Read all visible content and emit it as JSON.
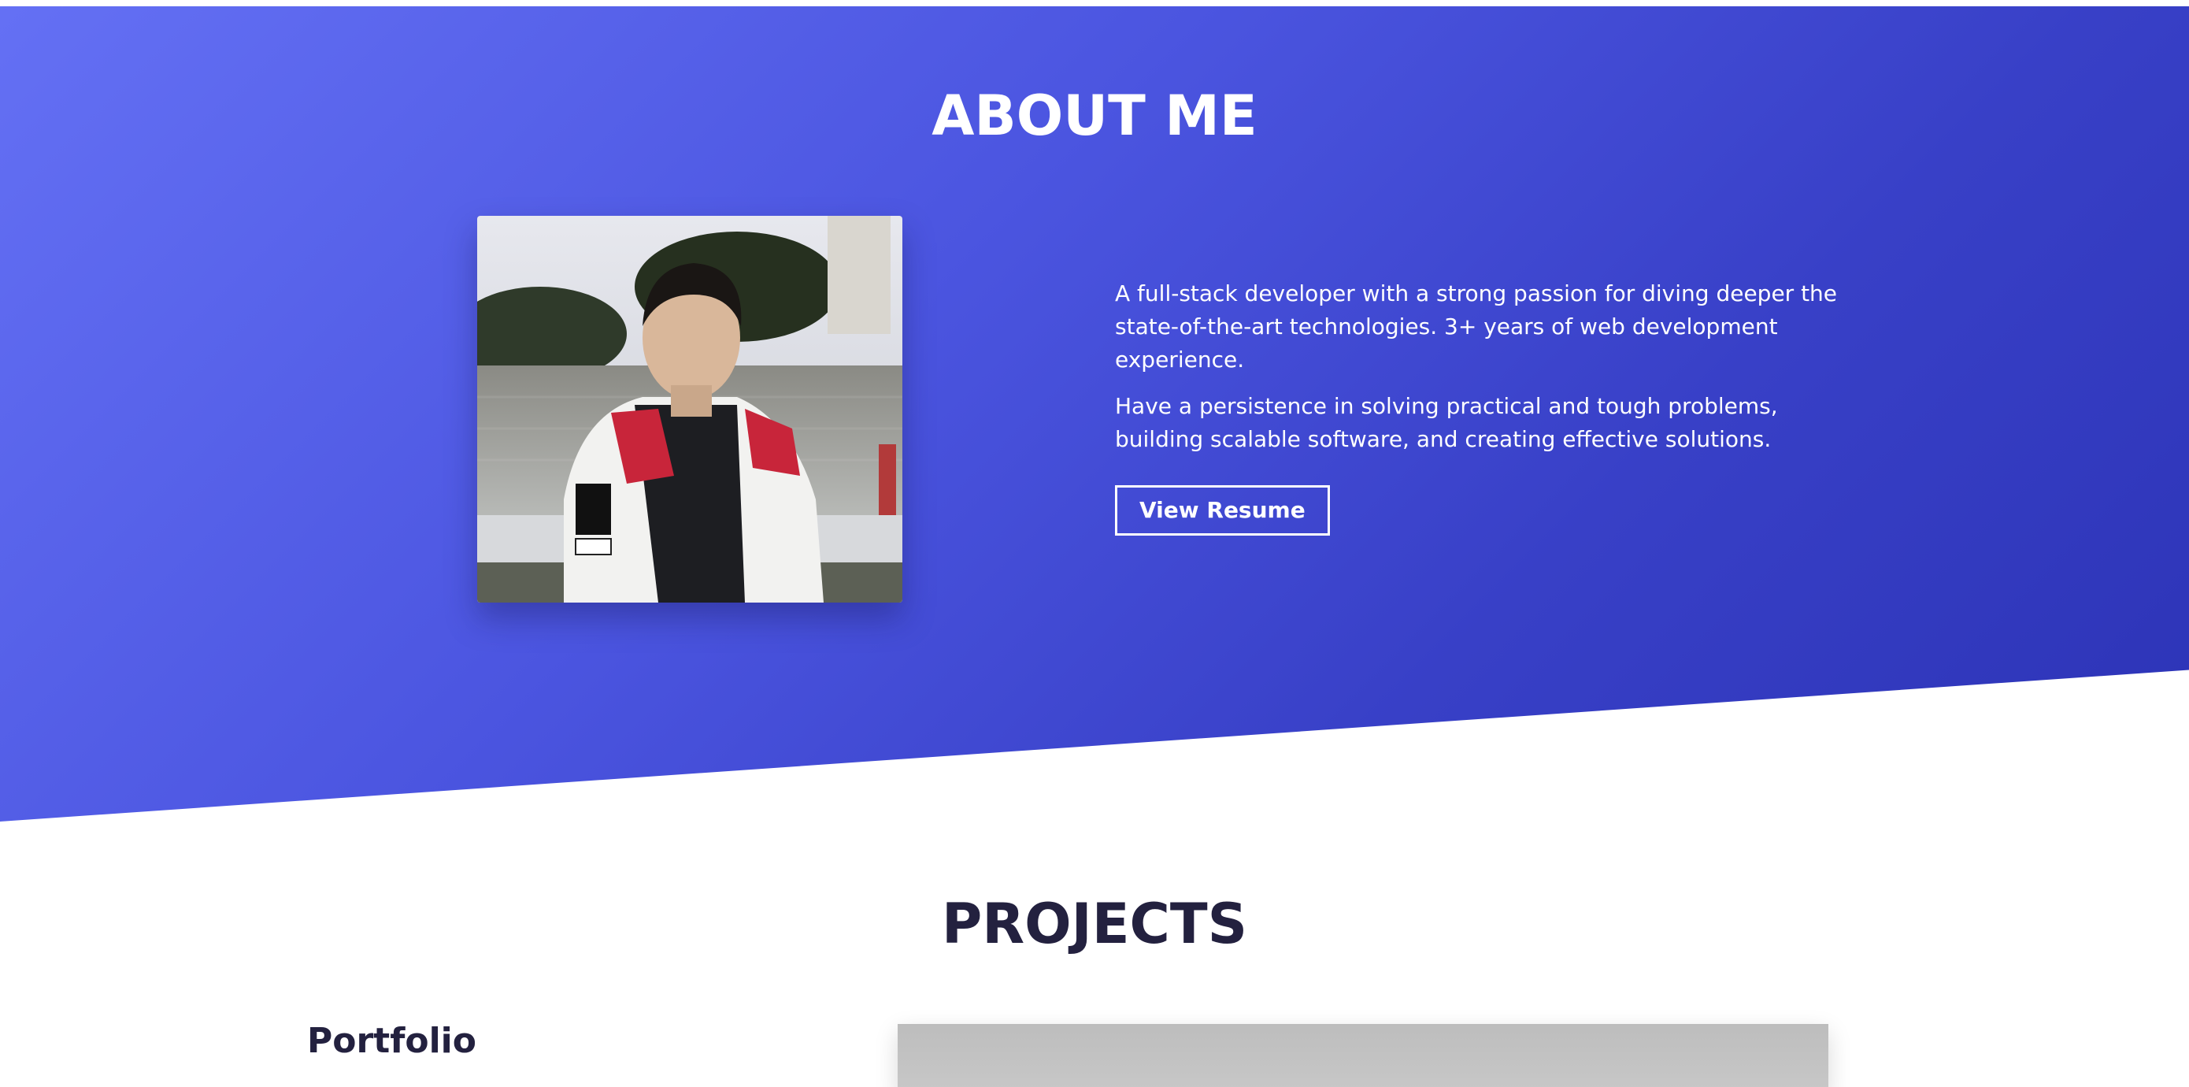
{
  "about": {
    "title": "ABOUT ME",
    "paragraphs": [
      "A full-stack developer with a strong passion for diving deeper the state-of-the-art technologies. 3+ years of web development experience.",
      "Have a persistence in solving practical and tough problems, building scalable software, and creating effective solutions."
    ],
    "resume_label": "View Resume",
    "gradient_colors": [
      "#6470f4",
      "#2c33b6"
    ]
  },
  "projects": {
    "title": "PROJECTS",
    "items": [
      {
        "title": "Portfolio"
      }
    ]
  },
  "colors": {
    "heading_dark": "#23213f",
    "accent": "#4b55e0"
  }
}
